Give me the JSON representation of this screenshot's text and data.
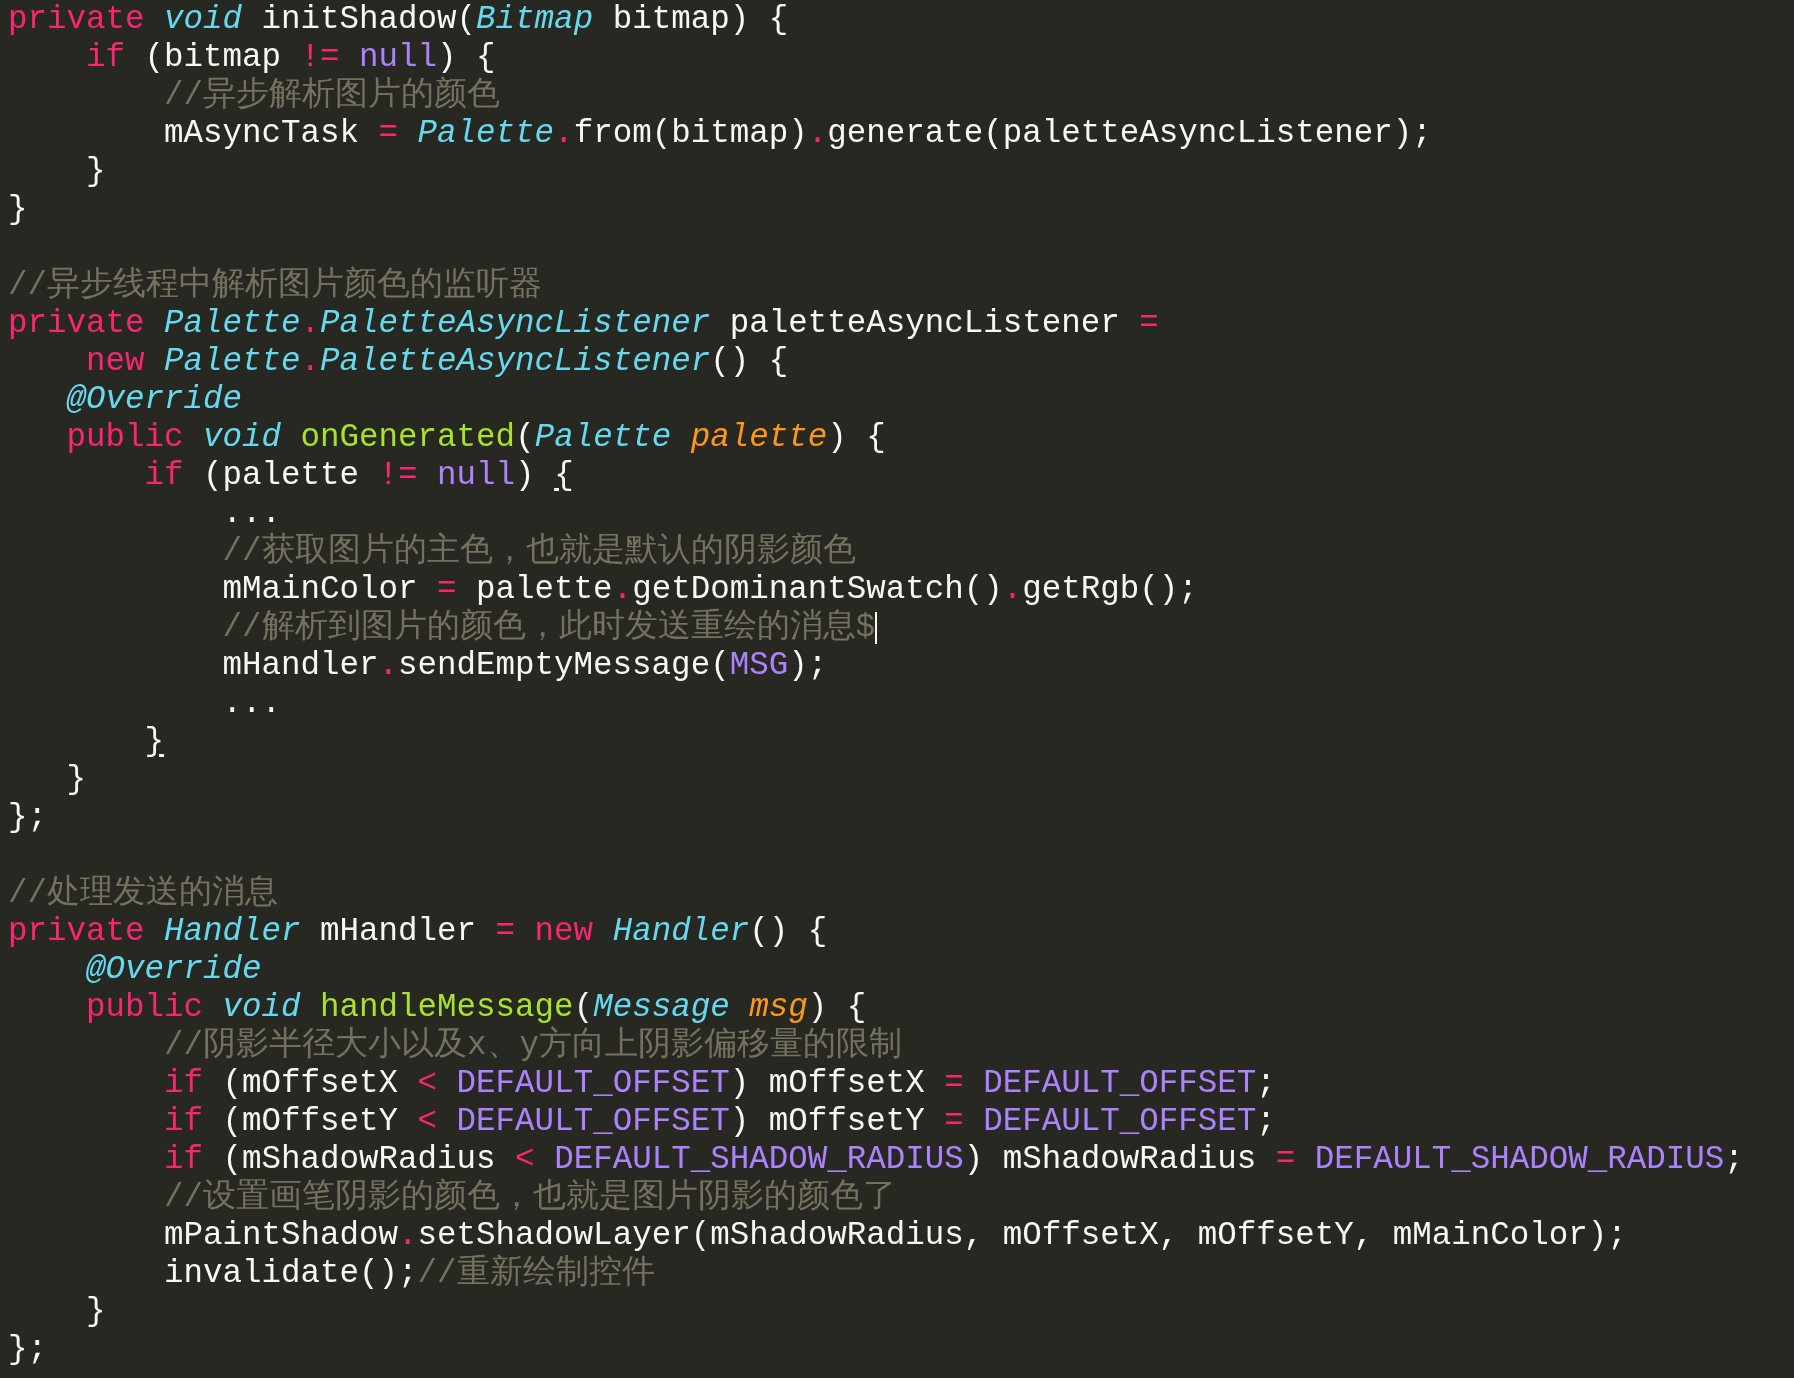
{
  "editor": {
    "lines": [
      {
        "kind": "code",
        "tokens": [
          {
            "kind": "kw",
            "text": "private "
          },
          {
            "kind": "ty",
            "text": "void "
          },
          {
            "kind": "tx",
            "text": "initShadow("
          },
          {
            "kind": "ty",
            "text": "Bitmap "
          },
          {
            "kind": "tx",
            "text": "bitmap) {"
          }
        ]
      },
      {
        "kind": "code",
        "tokens": [
          {
            "kind": "kw",
            "text": "    if "
          },
          {
            "kind": "tx",
            "text": "(bitmap "
          },
          {
            "kind": "op",
            "text": "!= "
          },
          {
            "kind": "co",
            "text": "null"
          },
          {
            "kind": "tx",
            "text": ") {"
          }
        ]
      },
      {
        "kind": "code",
        "tokens": [
          {
            "kind": "cm",
            "text": "        //异步解析图片的颜色"
          }
        ]
      },
      {
        "kind": "code",
        "tokens": [
          {
            "kind": "tx",
            "text": "        mAsyncTask "
          },
          {
            "kind": "op",
            "text": "= "
          },
          {
            "kind": "ty",
            "text": "Palette"
          },
          {
            "kind": "op",
            "text": "."
          },
          {
            "kind": "tx",
            "text": "from(bitmap)"
          },
          {
            "kind": "op",
            "text": "."
          },
          {
            "kind": "tx",
            "text": "generate(paletteAsyncListener);"
          }
        ]
      },
      {
        "kind": "code",
        "tokens": [
          {
            "kind": "tx",
            "text": "    }"
          }
        ]
      },
      {
        "kind": "code",
        "tokens": [
          {
            "kind": "tx",
            "text": "}"
          }
        ]
      },
      {
        "kind": "blank"
      },
      {
        "kind": "code",
        "tokens": [
          {
            "kind": "cm",
            "text": "//异步线程中解析图片颜色的监听器"
          }
        ]
      },
      {
        "kind": "code",
        "tokens": [
          {
            "kind": "kw",
            "text": "private "
          },
          {
            "kind": "ty",
            "text": "Palette"
          },
          {
            "kind": "op",
            "text": "."
          },
          {
            "kind": "ty",
            "text": "PaletteAsyncListener "
          },
          {
            "kind": "tx",
            "text": "paletteAsyncListener "
          },
          {
            "kind": "op",
            "text": "="
          }
        ]
      },
      {
        "kind": "code",
        "tokens": [
          {
            "kind": "kw",
            "text": "    new "
          },
          {
            "kind": "ty",
            "text": "Palette"
          },
          {
            "kind": "op",
            "text": "."
          },
          {
            "kind": "ty",
            "text": "PaletteAsyncListener"
          },
          {
            "kind": "tx",
            "text": "() {"
          }
        ]
      },
      {
        "kind": "code",
        "tokens": [
          {
            "kind": "an",
            "text": "   @Override"
          }
        ]
      },
      {
        "kind": "code",
        "tokens": [
          {
            "kind": "kw",
            "text": "   public "
          },
          {
            "kind": "ty",
            "text": "void "
          },
          {
            "kind": "fn",
            "text": "onGenerated"
          },
          {
            "kind": "tx",
            "text": "("
          },
          {
            "kind": "ty",
            "text": "Palette "
          },
          {
            "kind": "pa",
            "text": "palette"
          },
          {
            "kind": "tx",
            "text": ") {"
          }
        ]
      },
      {
        "kind": "code",
        "tokens": [
          {
            "kind": "kw",
            "text": "       if "
          },
          {
            "kind": "tx",
            "text": "(palette "
          },
          {
            "kind": "op",
            "text": "!= "
          },
          {
            "kind": "co",
            "text": "null"
          },
          {
            "kind": "tx",
            "text": ") "
          },
          {
            "kind": "br",
            "text": "{"
          }
        ]
      },
      {
        "kind": "code",
        "tokens": [
          {
            "kind": "tx",
            "text": "           ..."
          }
        ]
      },
      {
        "kind": "code",
        "tokens": [
          {
            "kind": "cm",
            "text": "           //获取图片的主色，也就是默认的阴影颜色"
          }
        ]
      },
      {
        "kind": "code",
        "tokens": [
          {
            "kind": "tx",
            "text": "           mMainColor "
          },
          {
            "kind": "op",
            "text": "= "
          },
          {
            "kind": "tx",
            "text": "palette"
          },
          {
            "kind": "op",
            "text": "."
          },
          {
            "kind": "tx",
            "text": "getDominantSwatch()"
          },
          {
            "kind": "op",
            "text": "."
          },
          {
            "kind": "tx",
            "text": "getRgb();"
          }
        ]
      },
      {
        "kind": "code",
        "cursor": true,
        "tokens": [
          {
            "kind": "cm",
            "text": "           //解析到图片的颜色，此时发送重绘的消息$"
          }
        ]
      },
      {
        "kind": "code",
        "tokens": [
          {
            "kind": "tx",
            "text": "           mHandler"
          },
          {
            "kind": "op",
            "text": "."
          },
          {
            "kind": "tx",
            "text": "sendEmptyMessage("
          },
          {
            "kind": "co",
            "text": "MSG"
          },
          {
            "kind": "tx",
            "text": ");"
          }
        ]
      },
      {
        "kind": "code",
        "tokens": [
          {
            "kind": "tx",
            "text": "           ..."
          }
        ]
      },
      {
        "kind": "code",
        "tokens": [
          {
            "kind": "br",
            "text": "       }"
          }
        ]
      },
      {
        "kind": "code",
        "tokens": [
          {
            "kind": "tx",
            "text": "   }"
          }
        ]
      },
      {
        "kind": "code",
        "tokens": [
          {
            "kind": "tx",
            "text": "};"
          }
        ]
      },
      {
        "kind": "blank"
      },
      {
        "kind": "code",
        "tokens": [
          {
            "kind": "cm",
            "text": "//处理发送的消息"
          }
        ]
      },
      {
        "kind": "code",
        "tokens": [
          {
            "kind": "kw",
            "text": "private "
          },
          {
            "kind": "ty",
            "text": "Handler "
          },
          {
            "kind": "tx",
            "text": "mHandler "
          },
          {
            "kind": "op",
            "text": "= "
          },
          {
            "kind": "kw",
            "text": "new "
          },
          {
            "kind": "ty",
            "text": "Handler"
          },
          {
            "kind": "tx",
            "text": "() {"
          }
        ]
      },
      {
        "kind": "code",
        "tokens": [
          {
            "kind": "an",
            "text": "    @Override"
          }
        ]
      },
      {
        "kind": "code",
        "tokens": [
          {
            "kind": "kw",
            "text": "    public "
          },
          {
            "kind": "ty",
            "text": "void "
          },
          {
            "kind": "fn",
            "text": "handleMessage"
          },
          {
            "kind": "tx",
            "text": "("
          },
          {
            "kind": "ty",
            "text": "Message "
          },
          {
            "kind": "pa",
            "text": "msg"
          },
          {
            "kind": "tx",
            "text": ") {"
          }
        ]
      },
      {
        "kind": "code",
        "tokens": [
          {
            "kind": "cm",
            "text": "        //阴影半径大小以及x、y方向上阴影偏移量的限制"
          }
        ]
      },
      {
        "kind": "code",
        "tokens": [
          {
            "kind": "kw",
            "text": "        if "
          },
          {
            "kind": "tx",
            "text": "(mOffsetX "
          },
          {
            "kind": "op",
            "text": "< "
          },
          {
            "kind": "co",
            "text": "DEFAULT_OFFSET"
          },
          {
            "kind": "tx",
            "text": ") mOffsetX "
          },
          {
            "kind": "op",
            "text": "= "
          },
          {
            "kind": "co",
            "text": "DEFAULT_OFFSET"
          },
          {
            "kind": "tx",
            "text": ";"
          }
        ]
      },
      {
        "kind": "code",
        "tokens": [
          {
            "kind": "kw",
            "text": "        if "
          },
          {
            "kind": "tx",
            "text": "(mOffsetY "
          },
          {
            "kind": "op",
            "text": "< "
          },
          {
            "kind": "co",
            "text": "DEFAULT_OFFSET"
          },
          {
            "kind": "tx",
            "text": ") mOffsetY "
          },
          {
            "kind": "op",
            "text": "= "
          },
          {
            "kind": "co",
            "text": "DEFAULT_OFFSET"
          },
          {
            "kind": "tx",
            "text": ";"
          }
        ]
      },
      {
        "kind": "code",
        "tokens": [
          {
            "kind": "kw",
            "text": "        if "
          },
          {
            "kind": "tx",
            "text": "(mShadowRadius "
          },
          {
            "kind": "op",
            "text": "< "
          },
          {
            "kind": "co",
            "text": "DEFAULT_SHADOW_RADIUS"
          },
          {
            "kind": "tx",
            "text": ") mShadowRadius "
          },
          {
            "kind": "op",
            "text": "= "
          },
          {
            "kind": "co",
            "text": "DEFAULT_SHADOW_RADIUS"
          },
          {
            "kind": "tx",
            "text": ";"
          }
        ]
      },
      {
        "kind": "code",
        "tokens": [
          {
            "kind": "cm",
            "text": "        //设置画笔阴影的颜色，也就是图片阴影的颜色了"
          }
        ]
      },
      {
        "kind": "code",
        "tokens": [
          {
            "kind": "tx",
            "text": "        mPaintShadow"
          },
          {
            "kind": "op",
            "text": "."
          },
          {
            "kind": "tx",
            "text": "setShadowLayer(mShadowRadius, mOffsetX, mOffsetY, mMainColor);"
          }
        ]
      },
      {
        "kind": "code",
        "tokens": [
          {
            "kind": "tx",
            "text": "        invalidate();"
          },
          {
            "kind": "cm",
            "text": "//重新绘制控件"
          }
        ]
      },
      {
        "kind": "code",
        "tokens": [
          {
            "kind": "tx",
            "text": "    }"
          }
        ]
      },
      {
        "kind": "code",
        "tokens": [
          {
            "kind": "tx",
            "text": "};"
          }
        ]
      }
    ]
  }
}
